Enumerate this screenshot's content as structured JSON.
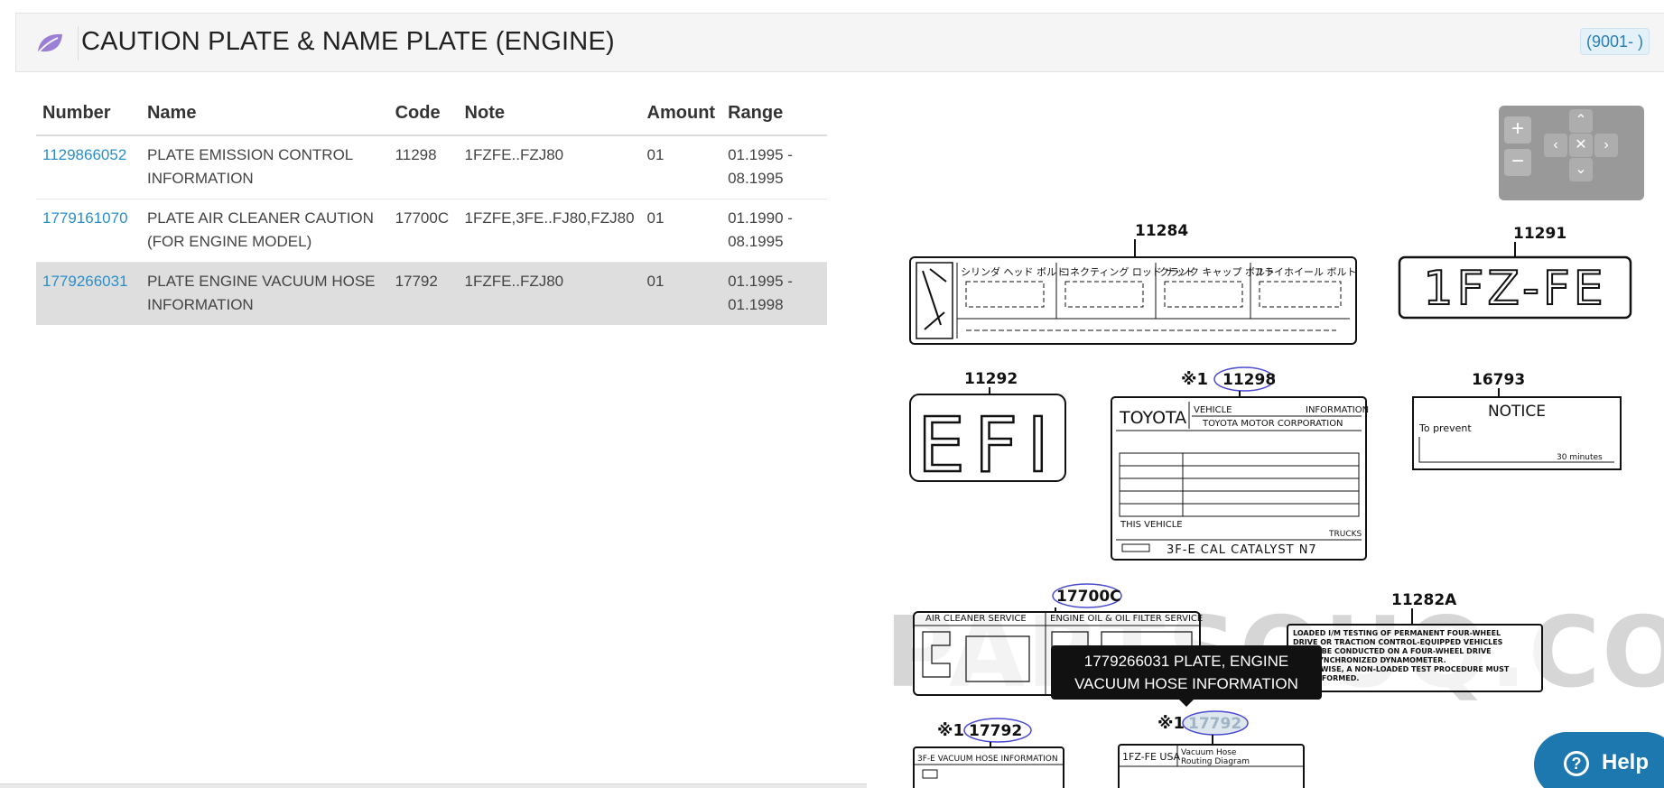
{
  "header": {
    "title": "CAUTION PLATE & NAME PLATE (ENGINE)",
    "range_badge": "(9001- )",
    "logo_icon": "leaf-icon",
    "accent_color": "#9b7fd4"
  },
  "table": {
    "columns": [
      "Number",
      "Name",
      "Code",
      "Note",
      "Amount",
      "Range"
    ],
    "rows": [
      {
        "number": "1129866052",
        "name": "PLATE EMISSION CONTROL INFORMATION",
        "code": "11298",
        "note": "1FZFE..FZJ80",
        "amount": "01",
        "range": "01.1995 - 08.1995"
      },
      {
        "number": "1779161070",
        "name": "PLATE AIR CLEANER CAUTION (FOR ENGINE MODEL)",
        "code": "17700C",
        "note": "1FZFE,3FE..FJ80,FZJ80",
        "amount": "01",
        "range": "01.1990 - 08.1995"
      },
      {
        "number": "1779266031",
        "name": "PLATE ENGINE VACUUM HOSE INFORMATION",
        "code": "17792",
        "note": "1FZFE..FZJ80",
        "amount": "01",
        "range": "01.1995 - 01.1998"
      }
    ],
    "link_color": "#2a8fc9",
    "highlight_row": 2
  },
  "diagram": {
    "labels": {
      "p11284": "11284",
      "p11291": "11291",
      "p11292": "11292",
      "p11298": "11298",
      "p16793": "16793",
      "p17700c": "17700C",
      "p11282a": "11282A",
      "p17792a": "17792",
      "p17792b": "17792",
      "asterisk": "※1"
    },
    "plate_texts": {
      "fz_fe": "1FZ-FE",
      "efi": "EFI",
      "toyota": "TOYOTA",
      "vehicle": "VEHICLE",
      "information": "INFORMATION",
      "corporation": "TOYOTA MOTOR CORPORATION",
      "this_vehicle": "THIS VEHICLE",
      "trucks": "TRUCKS",
      "catalyst": "3F-E CAL CATALYST N7",
      "notice": "NOTICE",
      "to_prevent": "To prevent",
      "minutes": "30 minutes",
      "air_cleaner": "AIR CLEANER SERVICE",
      "engine_oil": "ENGINE OIL & OIL FILTER SERVICE",
      "loaded_text_1": "LOADED I/M TESTING OF PERMANENT FOUR-WHEEL",
      "loaded_text_2": "DRIVE OR TRACTION CONTROL-EQUIPPED VEHICLES",
      "loaded_text_3": "SHALL BE CONDUCTED ON A FOUR-WHEEL DRIVE",
      "loaded_text_4": "AND SYNCHRONIZED DYNAMOMETER.",
      "loaded_text_5": "OTHERWISE, A NON-LOADED TEST PROCEDURE MUST",
      "loaded_text_6": "BE PERFORMED.",
      "vac_info": "3F-E VACUUM HOSE INFORMATION",
      "fz_fe_usa": "1FZ-FE USA",
      "vacuum_hose": "Vacuum Hose",
      "routing_diagram": "Routing Diagram",
      "jp_1": "シリンダ ヘッド ボルト",
      "jp_2": "コネクティング ロッド ナット",
      "jp_3": "クランク キャップ ボルト",
      "jp_4": "フライホイール ボルト",
      "watermark": "PARTSOUQ.COM"
    },
    "zoom": {
      "plus": "+",
      "minus": "−",
      "up": "⌃",
      "down": "⌄",
      "left": "‹",
      "right": "›",
      "reset": "✕"
    },
    "tooltip": {
      "line1": "1779266031 PLATE, ENGINE",
      "line2": "VACUUM HOSE INFORMATION"
    },
    "callout_color": "#4a4ad0"
  },
  "help": {
    "label": "Help",
    "icon": "question-icon"
  }
}
